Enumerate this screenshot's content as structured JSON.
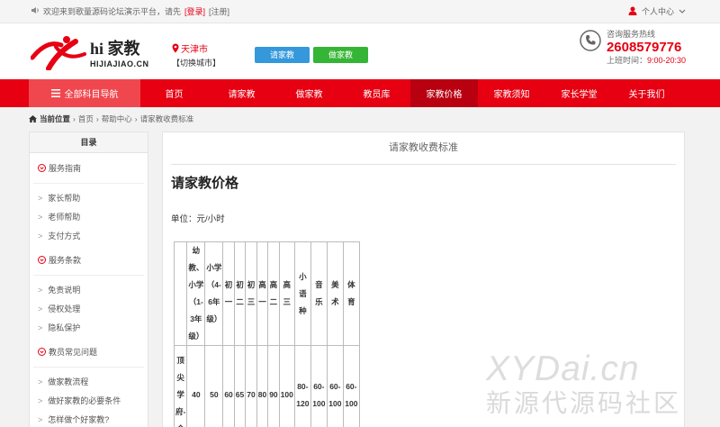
{
  "topbar": {
    "welcome": "欢迎来到歌量源码论坛演示平台，请先",
    "login": "[登录]",
    "register": "[注册]",
    "user_center": "个人中心"
  },
  "header": {
    "logo_cn": "hi 家教",
    "logo_en": "HIJIAJIAO.CN",
    "city": "天津市",
    "switch_city": "【切换城市】",
    "btn_hire": "请家教",
    "btn_tutor": "做家教",
    "hotline_label": "咨询服务热线",
    "phone": "2608579776",
    "hours_label": "上班时间：",
    "hours": "9:00-20:30"
  },
  "nav": {
    "all": "全部科目导航",
    "items": [
      "首页",
      "请家教",
      "做家教",
      "教员库",
      "家教价格",
      "家教须知",
      "家长学堂",
      "关于我们"
    ]
  },
  "breadcrumb": {
    "current": "当前位置",
    "home": "首页",
    "help": "帮助中心",
    "page": "请家教收费标准"
  },
  "sidebar": {
    "title": "目录",
    "groups": [
      {
        "label": "服务指南",
        "items": [
          "家长帮助",
          "老师帮助",
          "支付方式"
        ]
      },
      {
        "label": "服务条款",
        "items": [
          "免责说明",
          "侵权处理",
          "隐私保护"
        ]
      },
      {
        "label": "教员常见问题",
        "items": [
          "做家教流程",
          "做好家教的必要条件",
          "怎样做个好家教?"
        ]
      }
    ]
  },
  "main": {
    "title": "请家教收费标准",
    "heading": "请家教价格",
    "unit": "单位：元/小时",
    "table": {
      "headers": [
        "幼教、小学（1-3年级）",
        "小学（4-6年级）",
        "初一",
        "初二",
        "初三",
        "高一",
        "高二",
        "高三",
        "小语种",
        "音乐",
        "美术",
        "体育"
      ],
      "row_label": "顶尖学府-金",
      "values": [
        "40",
        "50",
        "60",
        "65",
        "70",
        "80",
        "90",
        "100",
        "80-120",
        "60-100",
        "60-100",
        "60-100"
      ]
    }
  },
  "watermark": {
    "line1": "XYDai.cn",
    "line2": "新源代源码社区"
  },
  "colors": {
    "brand_red": "#e60012",
    "nav_all": "#f0474e",
    "nav_active": "#b80010",
    "btn_blue": "#3498db",
    "btn_green": "#35b535"
  }
}
